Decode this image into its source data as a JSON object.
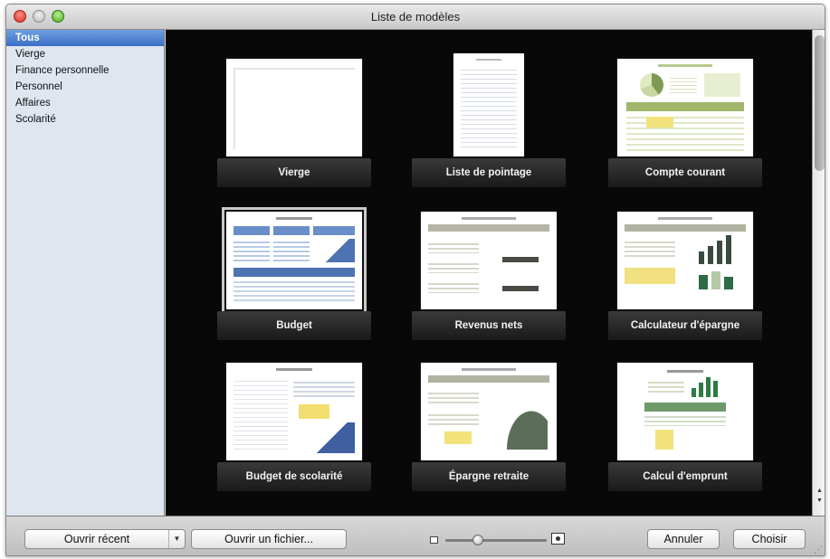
{
  "window": {
    "title": "Liste de modèles"
  },
  "sidebar": {
    "items": [
      {
        "label": "Tous",
        "selected": true
      },
      {
        "label": "Vierge",
        "selected": false
      },
      {
        "label": "Finance personnelle",
        "selected": false
      },
      {
        "label": "Personnel",
        "selected": false
      },
      {
        "label": "Affaires",
        "selected": false
      },
      {
        "label": "Scolarité",
        "selected": false
      }
    ]
  },
  "templates": [
    {
      "label": "Vierge"
    },
    {
      "label": "Liste de pointage"
    },
    {
      "label": "Compte courant"
    },
    {
      "label": "Budget",
      "selected": true
    },
    {
      "label": "Revenus nets"
    },
    {
      "label": "Calculateur d'épargne"
    },
    {
      "label": "Budget de scolarité"
    },
    {
      "label": "Épargne retraite"
    },
    {
      "label": "Calcul d'emprunt"
    }
  ],
  "footer": {
    "open_recent": "Ouvrir récent",
    "open_file": "Ouvrir un fichier...",
    "cancel": "Annuler",
    "choose": "Choisir",
    "zoom_level": 0.3
  },
  "icons": {
    "close": "close-icon",
    "minimize": "minimize-icon",
    "zoom": "zoom-icon",
    "dropdown": "chevron-down-icon",
    "zoom_small": "small-thumbnail-icon",
    "zoom_large": "large-thumbnail-icon"
  },
  "colors": {
    "selection": "#3b6fc7",
    "gallery_bg": "#080808",
    "sidebar_bg": "#dfe6f0"
  }
}
